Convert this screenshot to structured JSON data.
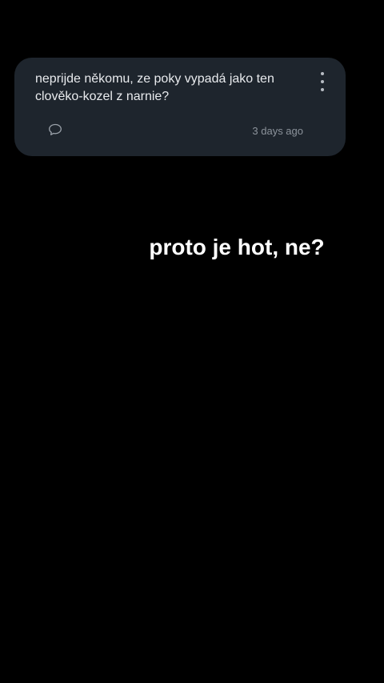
{
  "question_card": {
    "text": "neprijde někomu, ze poky vypadá jako ten clověko-kozel z narnie?",
    "timestamp": "3 days ago",
    "menu_icon": "more-vertical-icon",
    "comment_icon": "comment-bubble-icon"
  },
  "answer": {
    "text": "proto je hot, ne?"
  },
  "colors": {
    "background": "#000000",
    "card": "#1e252d",
    "question_text": "#e9ebee",
    "meta_text": "#8c939b",
    "answer_text": "#ffffff"
  }
}
